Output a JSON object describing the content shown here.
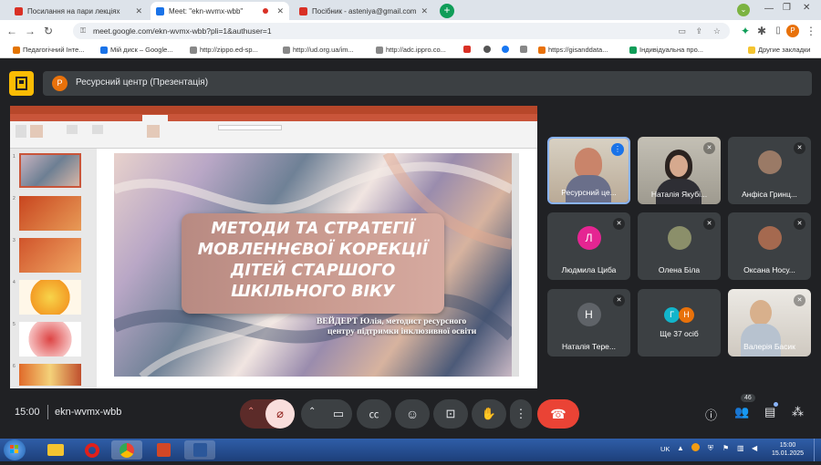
{
  "browser": {
    "tabs": [
      {
        "label": "Посилання на пари лекціях",
        "favicon_color": "#d93025",
        "active": false
      },
      {
        "label": "Meet: \"ekn-wvmx-wbb\"",
        "favicon_color": "#1a73e8",
        "active": true
      },
      {
        "label": "Посібник - asteniya@gmail.com",
        "favicon_color": "#d93025",
        "active": false
      }
    ],
    "new_tab": "+",
    "url": "meet.google.com/ekn-wvmx-wbb?pli=1&authuser=1",
    "profile_initial": "P",
    "bookmarks": [
      {
        "label": "Педагогічний Інте...",
        "color": "#e37400"
      },
      {
        "label": "Мій диск – Google...",
        "color": "#1a73e8"
      },
      {
        "label": "http://zippo.ed-sp...",
        "color": "#555"
      },
      {
        "label": "http://ud.org.ua/im...",
        "color": "#555"
      },
      {
        "label": "http://adc.ippro.co...",
        "color": "#555"
      },
      {
        "label": "",
        "color": "#d93025"
      },
      {
        "label": "",
        "color": "#1877f2"
      },
      {
        "label": "https://gisanddata...",
        "color": "#555"
      },
      {
        "label": "Індивідуальна про...",
        "color": "#0f9d58"
      }
    ],
    "other_bookmarks": "Другие закладки"
  },
  "meeting": {
    "presenter_initial": "P",
    "presentation_title": "Ресурсний центр (Презентація)",
    "time": "15:00",
    "code": "ekn-wvmx-wbb",
    "participants_count": "46"
  },
  "slide": {
    "title_lines": [
      "МЕТОДИ ТА СТРАТЕГІЇ",
      "МОВЛЕННЄВОЇ КОРЕКЦІЇ",
      "ДІТЕЙ СТАРШОГО",
      "ШКІЛЬНОГО ВІКУ"
    ],
    "author_lines": [
      "ВЕЙДЕРТ Юлія, методист ресурсного",
      "центру підтримки інклюзивної освіти"
    ],
    "thumb_numbers": [
      "1",
      "2",
      "3",
      "4",
      "5",
      "6"
    ]
  },
  "participants": [
    {
      "name": "Ресурсний це...",
      "type": "video",
      "color": "#c9a27e"
    },
    {
      "name": "Наталія Якубі...",
      "type": "video",
      "color": "#b7b3a8"
    },
    {
      "name": "Анфіса Гринц...",
      "type": "photo",
      "color": "#9a7a66"
    },
    {
      "name": "Людмила Циба",
      "type": "letter",
      "letter": "Л",
      "color": "#e52592"
    },
    {
      "name": "Олена Біла",
      "type": "photo",
      "color": "#8b8f6a"
    },
    {
      "name": "Оксана Носу...",
      "type": "photo",
      "color": "#a5694f"
    },
    {
      "name": "Наталія Тере...",
      "type": "letter",
      "letter": "Н",
      "color": "#5f6368"
    },
    {
      "name": "Ще 37 осіб",
      "type": "more",
      "letters": [
        "Г",
        "Н"
      ],
      "colors": [
        "#12b5cb",
        "#e8710a"
      ]
    },
    {
      "name": "Валерія Басик",
      "type": "video",
      "color": "#d9d4cc"
    }
  ],
  "taskbar": {
    "lang": "UK",
    "clock_time": "15:00",
    "clock_date": "15.01.2025"
  }
}
